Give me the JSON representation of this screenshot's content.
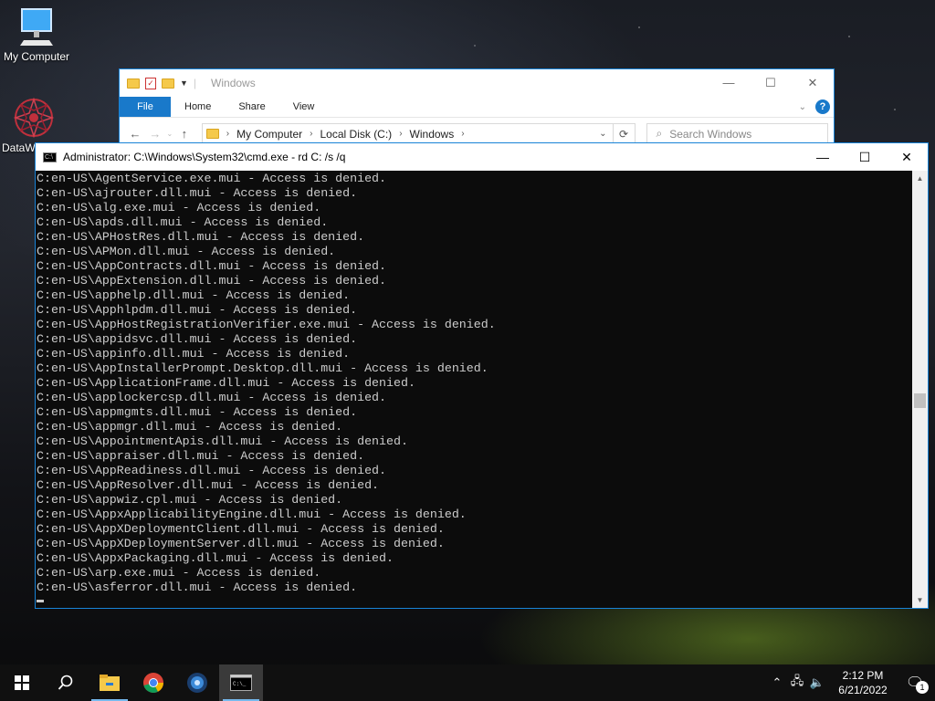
{
  "desktop": {
    "icons": [
      {
        "label": "My Computer"
      },
      {
        "label": "DataW"
      }
    ]
  },
  "explorer": {
    "title": "Windows",
    "caption": {
      "minimize": "—",
      "maximize": "☐",
      "close": "✕"
    },
    "ribbon_tabs": [
      "File",
      "Home",
      "Share",
      "View"
    ],
    "address": {
      "parts": [
        "My Computer",
        "Local Disk (C:)",
        "Windows"
      ]
    },
    "search_placeholder": "Search Windows"
  },
  "cmd": {
    "title": "Administrator: C:\\Windows\\System32\\cmd.exe - rd  C: /s /q",
    "caption": {
      "minimize": "—",
      "maximize": "☐",
      "close": "✕"
    },
    "lines": [
      "C:en-US\\AgentService.exe.mui - Access is denied.",
      "C:en-US\\ajrouter.dll.mui - Access is denied.",
      "C:en-US\\alg.exe.mui - Access is denied.",
      "C:en-US\\apds.dll.mui - Access is denied.",
      "C:en-US\\APHostRes.dll.mui - Access is denied.",
      "C:en-US\\APMon.dll.mui - Access is denied.",
      "C:en-US\\AppContracts.dll.mui - Access is denied.",
      "C:en-US\\AppExtension.dll.mui - Access is denied.",
      "C:en-US\\apphelp.dll.mui - Access is denied.",
      "C:en-US\\Apphlpdm.dll.mui - Access is denied.",
      "C:en-US\\AppHostRegistrationVerifier.exe.mui - Access is denied.",
      "C:en-US\\appidsvc.dll.mui - Access is denied.",
      "C:en-US\\appinfo.dll.mui - Access is denied.",
      "C:en-US\\AppInstallerPrompt.Desktop.dll.mui - Access is denied.",
      "C:en-US\\ApplicationFrame.dll.mui - Access is denied.",
      "C:en-US\\applockercsp.dll.mui - Access is denied.",
      "C:en-US\\appmgmts.dll.mui - Access is denied.",
      "C:en-US\\appmgr.dll.mui - Access is denied.",
      "C:en-US\\AppointmentApis.dll.mui - Access is denied.",
      "C:en-US\\appraiser.dll.mui - Access is denied.",
      "C:en-US\\AppReadiness.dll.mui - Access is denied.",
      "C:en-US\\AppResolver.dll.mui - Access is denied.",
      "C:en-US\\appwiz.cpl.mui - Access is denied.",
      "C:en-US\\AppxApplicabilityEngine.dll.mui - Access is denied.",
      "C:en-US\\AppXDeploymentClient.dll.mui - Access is denied.",
      "C:en-US\\AppXDeploymentServer.dll.mui - Access is denied.",
      "C:en-US\\AppxPackaging.dll.mui - Access is denied.",
      "C:en-US\\arp.exe.mui - Access is denied.",
      "C:en-US\\asferror.dll.mui - Access is denied."
    ]
  },
  "taskbar": {
    "apps": [
      "start-icon",
      "search-icon",
      "file-explorer-icon",
      "chrome-icon",
      "app-icon",
      "cmd-icon"
    ],
    "clock_time": "2:12 PM",
    "clock_date": "6/21/2022",
    "notification_count": "1"
  }
}
